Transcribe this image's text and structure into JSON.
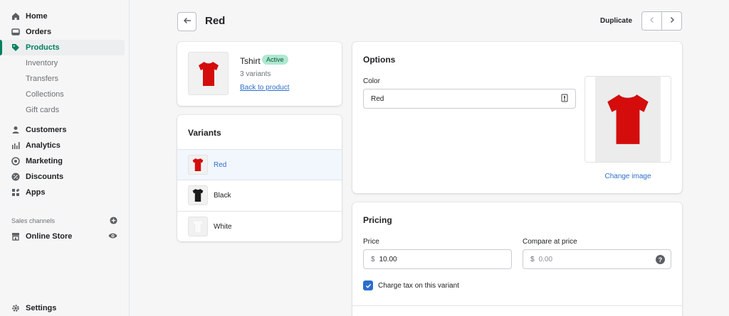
{
  "sidebar": {
    "items_top": [
      {
        "label": "Home",
        "icon": "home-icon"
      },
      {
        "label": "Orders",
        "icon": "orders-icon"
      },
      {
        "label": "Products",
        "icon": "tag-icon",
        "active": true
      }
    ],
    "product_sub": [
      "Inventory",
      "Transfers",
      "Collections",
      "Gift cards"
    ],
    "items_mid": [
      {
        "label": "Customers",
        "icon": "person-icon"
      },
      {
        "label": "Analytics",
        "icon": "bar-chart-icon"
      },
      {
        "label": "Marketing",
        "icon": "target-icon"
      },
      {
        "label": "Discounts",
        "icon": "discount-icon"
      },
      {
        "label": "Apps",
        "icon": "apps-icon"
      }
    ],
    "sales_channels_label": "Sales channels",
    "online_store": "Online Store",
    "settings": "Settings"
  },
  "header": {
    "title": "Red",
    "duplicate": "Duplicate"
  },
  "product": {
    "name": "Tshirt",
    "status": "Active",
    "variants_count": "3 variants",
    "back_link": "Back to product"
  },
  "variants": {
    "title": "Variants",
    "items": [
      {
        "label": "Red",
        "color": "#d40c0c",
        "selected": true
      },
      {
        "label": "Black",
        "color": "#1a1a1a",
        "selected": false
      },
      {
        "label": "White",
        "color": "#fafafa",
        "selected": false
      }
    ]
  },
  "options": {
    "title": "Options",
    "color_label": "Color",
    "color_value": "Red",
    "change_image": "Change image"
  },
  "pricing": {
    "title": "Pricing",
    "price_label": "Price",
    "price_currency": "$",
    "price_value": "10.00",
    "compare_label": "Compare at price",
    "compare_currency": "$",
    "compare_placeholder": "0.00",
    "tax_label": "Charge tax on this variant",
    "tax_checked": true
  },
  "colors": {
    "accent": "#008060",
    "link": "#2c6ecb",
    "badge_bg": "#aee9d1"
  }
}
